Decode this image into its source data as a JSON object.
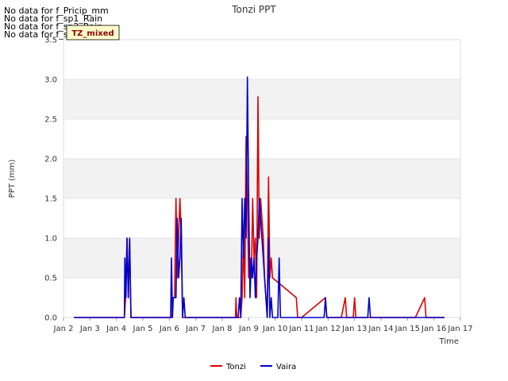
{
  "chart_data": {
    "type": "line",
    "title": "Tonzi PPT",
    "xlabel": "Time",
    "ylabel": "PPT (mm)",
    "ylim": [
      0,
      3.5
    ],
    "xlim": [
      "Jan 2",
      "Jan 17"
    ],
    "x_ticks": [
      "Jan 2",
      "Jan 3",
      "Jan 4",
      "Jan 5",
      "Jan 6",
      "Jan 7",
      "Jan 8",
      "Jan 9",
      "Jan 10",
      "Jan 11",
      "Jan 12",
      "Jan 13",
      "Jan 14",
      "Jan 15",
      "Jan 16",
      "Jan 17"
    ],
    "y_ticks": [
      "0.0",
      "0.5",
      "1.0",
      "1.5",
      "2.0",
      "2.5",
      "3.0",
      "3.5"
    ],
    "grid": "horizontal bands",
    "legend_position": "bottom-center",
    "badge": "TZ_mixed",
    "no_data_messages": [
      "No data for f_Pricip_mm",
      "No data for f_sp1_Rain",
      "No data for f_sp2_Rain",
      "No data for f_sp3_Rain"
    ],
    "series": [
      {
        "name": "Tonzi",
        "color": "#dd0000",
        "points": [
          [
            2.4,
            0
          ],
          [
            4.3,
            0
          ],
          [
            4.35,
            0.25
          ],
          [
            4.4,
            1.0
          ],
          [
            4.45,
            0.25
          ],
          [
            4.5,
            1.0
          ],
          [
            4.55,
            0
          ],
          [
            6.1,
            0
          ],
          [
            6.12,
            0.25
          ],
          [
            6.2,
            0.25
          ],
          [
            6.25,
            1.5
          ],
          [
            6.3,
            0.5
          ],
          [
            6.35,
            1.0
          ],
          [
            6.4,
            1.5
          ],
          [
            6.45,
            1.0
          ],
          [
            6.5,
            0
          ],
          [
            8.5,
            0
          ],
          [
            8.52,
            0.25
          ],
          [
            8.55,
            0
          ],
          [
            8.7,
            0
          ],
          [
            8.75,
            0.25
          ],
          [
            8.8,
            1.0
          ],
          [
            8.85,
            0.25
          ],
          [
            8.9,
            2.28
          ],
          [
            8.95,
            1.5
          ],
          [
            9.0,
            0.5
          ],
          [
            9.05,
            0.75
          ],
          [
            9.1,
            0.5
          ],
          [
            9.15,
            1.5
          ],
          [
            9.2,
            0.75
          ],
          [
            9.25,
            1.0
          ],
          [
            9.3,
            0.25
          ],
          [
            9.35,
            2.78
          ],
          [
            9.4,
            1.0
          ],
          [
            9.45,
            1.5
          ],
          [
            9.5,
            1.25
          ],
          [
            9.55,
            1.0
          ],
          [
            9.6,
            0.5
          ],
          [
            9.65,
            0.25
          ],
          [
            9.7,
            0
          ],
          [
            9.75,
            1.77
          ],
          [
            9.8,
            0.5
          ],
          [
            9.85,
            0.75
          ],
          [
            9.9,
            0.5
          ],
          [
            10.8,
            0.25
          ],
          [
            10.85,
            0
          ],
          [
            11.0,
            0
          ],
          [
            11.9,
            0.25
          ],
          [
            11.95,
            0
          ],
          [
            12.5,
            0
          ],
          [
            12.65,
            0.25
          ],
          [
            12.7,
            0
          ],
          [
            12.95,
            0
          ],
          [
            13.0,
            0.25
          ],
          [
            13.05,
            0
          ],
          [
            15.3,
            0
          ],
          [
            15.65,
            0.25
          ],
          [
            15.7,
            0
          ],
          [
            16.4,
            0
          ]
        ]
      },
      {
        "name": "Vaira",
        "color": "#0000cc",
        "points": [
          [
            2.4,
            0
          ],
          [
            4.3,
            0
          ],
          [
            4.32,
            0.75
          ],
          [
            4.36,
            0.25
          ],
          [
            4.4,
            1.0
          ],
          [
            4.45,
            0.25
          ],
          [
            4.5,
            1.0
          ],
          [
            4.55,
            0
          ],
          [
            6.05,
            0
          ],
          [
            6.08,
            0.75
          ],
          [
            6.12,
            0
          ],
          [
            6.15,
            0.25
          ],
          [
            6.25,
            0.25
          ],
          [
            6.3,
            1.25
          ],
          [
            6.35,
            0.5
          ],
          [
            6.4,
            0.75
          ],
          [
            6.45,
            1.25
          ],
          [
            6.5,
            0
          ],
          [
            6.55,
            0.25
          ],
          [
            6.6,
            0
          ],
          [
            8.6,
            0
          ],
          [
            8.65,
            0.25
          ],
          [
            8.7,
            0
          ],
          [
            8.75,
            1.5
          ],
          [
            8.8,
            0.75
          ],
          [
            8.85,
            1.5
          ],
          [
            8.9,
            1.0
          ],
          [
            8.95,
            3.03
          ],
          [
            9.0,
            1.5
          ],
          [
            9.05,
            0.25
          ],
          [
            9.1,
            0.75
          ],
          [
            9.15,
            0.5
          ],
          [
            9.2,
            0.75
          ],
          [
            9.25,
            0.25
          ],
          [
            9.3,
            0.75
          ],
          [
            9.35,
            1.0
          ],
          [
            9.4,
            1.5
          ],
          [
            9.45,
            1.25
          ],
          [
            9.5,
            1.0
          ],
          [
            9.55,
            0.75
          ],
          [
            9.6,
            0.5
          ],
          [
            9.65,
            0.25
          ],
          [
            9.7,
            0
          ],
          [
            9.75,
            1.0
          ],
          [
            9.8,
            0
          ],
          [
            9.85,
            0.25
          ],
          [
            9.9,
            0
          ],
          [
            10.1,
            0
          ],
          [
            10.15,
            0.75
          ],
          [
            10.2,
            0
          ],
          [
            11.85,
            0
          ],
          [
            11.9,
            0.25
          ],
          [
            11.95,
            0
          ],
          [
            13.5,
            0
          ],
          [
            13.55,
            0.25
          ],
          [
            13.6,
            0
          ],
          [
            16.4,
            0
          ]
        ]
      }
    ]
  }
}
